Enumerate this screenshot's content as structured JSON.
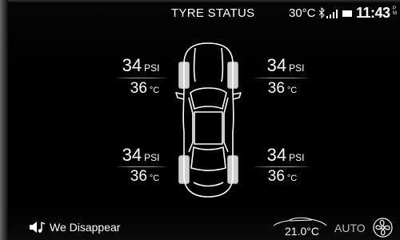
{
  "header": {
    "title": "TYRE STATUS",
    "outside_temp": "30°C",
    "time": "11:43",
    "ampm_top": "P",
    "ampm_bottom": "M",
    "icons": [
      "bluetooth-icon",
      "signal-icon",
      "battery-icon"
    ]
  },
  "tyres": {
    "front_left": {
      "pressure": "34",
      "pressure_unit": "PSI",
      "temp": "36",
      "temp_unit": "°C"
    },
    "front_right": {
      "pressure": "34",
      "pressure_unit": "PSI",
      "temp": "36",
      "temp_unit": "°C"
    },
    "rear_left": {
      "pressure": "34",
      "pressure_unit": "PSI",
      "temp": "36",
      "temp_unit": "°C"
    },
    "rear_right": {
      "pressure": "34",
      "pressure_unit": "PSI",
      "temp": "36",
      "temp_unit": "°C"
    }
  },
  "media": {
    "icon": "music-note-icon",
    "track": "We Disappear"
  },
  "climate": {
    "icon": "car-silhouette-icon",
    "cabin_temp": "21.0°C",
    "mode": "AUTO",
    "fan_icon": "fan-icon"
  }
}
